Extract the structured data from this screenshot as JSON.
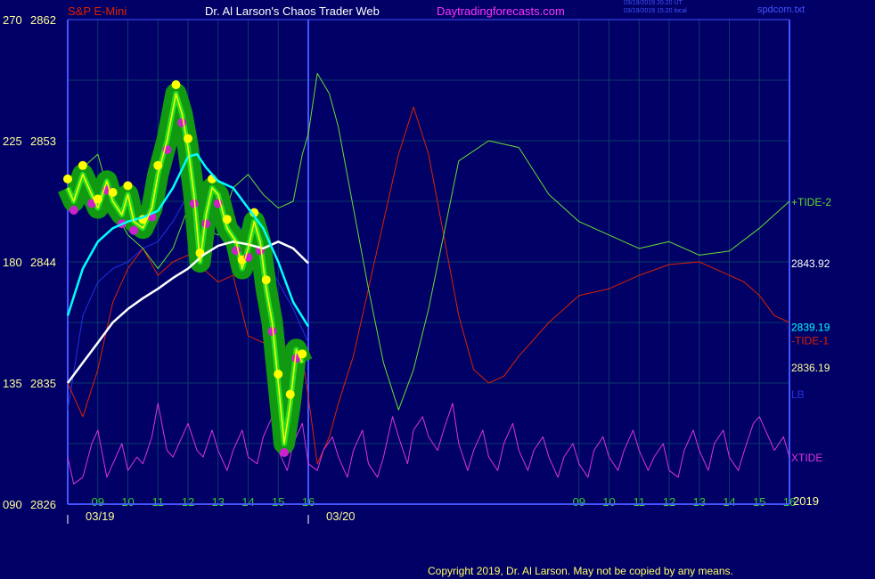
{
  "header": {
    "symbol": "S&P E-Mini",
    "title": "Dr. Al Larson's Chaos Trader Web",
    "site": "Daytradingforecasts.com",
    "timestamp_ut": "03/19/2019 20:20 UT",
    "timestamp_local": "03/19/2019 15:20 local",
    "file": "spdcom.txt",
    "copyright": "Copyright 2019, Dr. Al Larson. May not be copied by any means."
  },
  "colors": {
    "background": "#000066",
    "grid": "#0a3a6a",
    "price": "#ffff00",
    "fast_avg": "#00ffff",
    "slow_avg": "#ffffff",
    "tide_plus2": "#66dd33",
    "tide_minus1": "#dd2200",
    "lb": "#2233dd",
    "xtide": "#dd33dd",
    "halo": "#119911",
    "axis": "#4455ff"
  },
  "chart_data": {
    "type": "line",
    "title": "S&P E-Mini",
    "ylim": [
      2826,
      2862
    ],
    "y_ticks_price": [
      "2826",
      "2835",
      "2844",
      "2853",
      "2862"
    ],
    "y_ticks_angle": [
      "090",
      "135",
      "180",
      "225",
      "270"
    ],
    "x_ticks_day1": [
      "09",
      "10",
      "11",
      "12",
      "13",
      "14",
      "15",
      "16"
    ],
    "x_ticks_day2": [
      "09",
      "10",
      "11",
      "12",
      "13",
      "14",
      "15",
      "16"
    ],
    "dates": [
      "03/19",
      "03/20"
    ],
    "year": "2019",
    "x_range_hours": [
      8.0,
      32.0
    ],
    "price_series": {
      "name": "S&P E-Mini",
      "x": [
        8.0,
        8.2,
        8.5,
        8.8,
        9.0,
        9.3,
        9.5,
        9.8,
        10.0,
        10.2,
        10.5,
        10.8,
        11.0,
        11.3,
        11.6,
        11.8,
        12.0,
        12.2,
        12.4,
        12.6,
        12.8,
        13.0,
        13.3,
        13.6,
        13.8,
        14.0,
        14.2,
        14.4,
        14.6,
        14.8,
        15.0,
        15.2,
        15.4,
        15.6,
        15.8
      ],
      "y": [
        2849.5,
        2848.5,
        2850.5,
        2849.0,
        2848.0,
        2850.0,
        2848.5,
        2847.5,
        2849.0,
        2847.0,
        2846.5,
        2848.0,
        2850.5,
        2853.0,
        2856.5,
        2855.0,
        2852.5,
        2849.0,
        2844.0,
        2847.5,
        2849.5,
        2849.0,
        2846.5,
        2845.5,
        2843.5,
        2845.0,
        2847.0,
        2845.5,
        2842.0,
        2839.5,
        2835.0,
        2830.5,
        2833.5,
        2837.5,
        2836.5
      ]
    },
    "fast_avg": {
      "name": "2839.19",
      "x": [
        8.0,
        8.5,
        9.0,
        9.5,
        10.0,
        10.5,
        11.0,
        11.5,
        12.0,
        12.3,
        12.6,
        13.0,
        13.5,
        14.0,
        14.5,
        15.0,
        15.5,
        16.0
      ],
      "y": [
        2840.0,
        2843.5,
        2845.5,
        2846.5,
        2847.0,
        2847.3,
        2847.8,
        2849.5,
        2851.8,
        2852.0,
        2851.0,
        2850.0,
        2849.5,
        2848.0,
        2846.5,
        2844.0,
        2841.0,
        2839.2
      ]
    },
    "slow_avg": {
      "name": "2843.92",
      "x": [
        8.0,
        8.5,
        9.0,
        9.5,
        10.0,
        10.5,
        11.0,
        11.5,
        12.0,
        12.5,
        13.0,
        13.5,
        14.0,
        14.5,
        15.0,
        15.5,
        16.0
      ],
      "y": [
        2835.0,
        2836.5,
        2838.0,
        2839.5,
        2840.5,
        2841.3,
        2842.0,
        2842.8,
        2843.5,
        2844.5,
        2845.2,
        2845.5,
        2845.3,
        2845.0,
        2845.5,
        2845.0,
        2843.9
      ]
    },
    "tide_plus2": {
      "name": "+TIDE-2",
      "x": [
        8.0,
        8.5,
        9.0,
        9.5,
        10.0,
        10.5,
        11.0,
        11.5,
        12.0,
        12.5,
        13.0,
        13.5,
        14.0,
        14.5,
        15.0,
        15.5,
        15.8,
        16.0,
        16.3,
        16.7,
        17.0,
        17.5,
        18.0,
        18.5,
        19.0,
        19.5,
        20.0,
        20.5,
        21.0,
        22.0,
        23.0,
        24.0,
        25.0,
        26.0,
        27.0,
        28.0,
        29.0,
        30.0,
        31.0,
        31.5,
        32.0
      ],
      "y": [
        2849.0,
        2851.0,
        2852.0,
        2848.0,
        2846.0,
        2845.0,
        2843.5,
        2845.0,
        2848.0,
        2846.5,
        2846.0,
        2849.5,
        2850.5,
        2849.0,
        2848.0,
        2848.5,
        2852.0,
        2853.5,
        2858.0,
        2856.5,
        2854.0,
        2848.0,
        2842.0,
        2836.5,
        2833.0,
        2836.0,
        2840.5,
        2846.0,
        2851.5,
        2853.0,
        2852.5,
        2849.0,
        2847.0,
        2846.0,
        2845.0,
        2845.5,
        2844.5,
        2844.8,
        2846.5,
        2847.5,
        2848.5
      ]
    },
    "tide_minus1": {
      "name": "-TIDE-1",
      "x": [
        8.0,
        8.5,
        9.0,
        9.5,
        10.0,
        10.5,
        11.0,
        11.5,
        12.0,
        12.5,
        13.0,
        13.5,
        14.0,
        14.5,
        15.0,
        15.5,
        15.8,
        16.0,
        16.3,
        16.7,
        17.0,
        17.5,
        18.0,
        18.5,
        19.0,
        19.5,
        20.0,
        20.5,
        21.0,
        21.5,
        22.0,
        22.5,
        23.0,
        24.0,
        25.0,
        26.0,
        27.0,
        28.0,
        29.0,
        29.5,
        30.0,
        30.5,
        31.0,
        31.5,
        32.0
      ],
      "y": [
        2835.0,
        2832.5,
        2836.0,
        2841.0,
        2843.5,
        2845.0,
        2843.0,
        2844.0,
        2844.5,
        2843.5,
        2842.5,
        2843.0,
        2838.5,
        2838.0,
        2837.5,
        2838.0,
        2837.0,
        2834.0,
        2829.0,
        2831.0,
        2833.5,
        2837.0,
        2842.0,
        2847.0,
        2852.0,
        2855.5,
        2852.0,
        2846.0,
        2840.0,
        2836.0,
        2835.0,
        2835.5,
        2837.0,
        2839.5,
        2841.5,
        2842.0,
        2843.0,
        2843.8,
        2844.0,
        2843.5,
        2843.0,
        2842.5,
        2841.5,
        2840.0,
        2839.5
      ]
    },
    "lb": {
      "name": "LB",
      "x": [
        8.0,
        8.5,
        9.0,
        9.5,
        10.0,
        10.5,
        11.0,
        11.5,
        12.0,
        12.5,
        13.0,
        13.5,
        14.0,
        14.5,
        15.0,
        15.5,
        16.0
      ],
      "y": [
        2833.0,
        2840.0,
        2842.5,
        2843.5,
        2844.0,
        2845.0,
        2845.5,
        2847.0,
        2849.0,
        2849.5,
        2848.5,
        2847.0,
        2846.0,
        2844.5,
        2842.5,
        2840.5,
        2838.0
      ]
    },
    "xtide": {
      "name": "XTIDE",
      "x": [
        8.0,
        8.2,
        8.5,
        8.8,
        9.0,
        9.3,
        9.5,
        9.8,
        10.0,
        10.3,
        10.5,
        10.8,
        11.0,
        11.3,
        11.5,
        11.8,
        12.0,
        12.3,
        12.5,
        12.8,
        13.0,
        13.3,
        13.5,
        13.8,
        14.0,
        14.3,
        14.5,
        14.8,
        15.0,
        15.3,
        15.5,
        15.8,
        16.0,
        16.3,
        16.5,
        16.8,
        17.0,
        17.3,
        17.5,
        17.8,
        18.0,
        18.3,
        18.5,
        18.8,
        19.0,
        19.3,
        19.5,
        19.8,
        20.0,
        20.3,
        20.5,
        20.8,
        21.0,
        21.3,
        21.5,
        21.8,
        22.0,
        22.3,
        22.5,
        22.8,
        23.0,
        23.3,
        23.5,
        23.8,
        24.0,
        24.3,
        24.5,
        24.8,
        25.0,
        25.3,
        25.5,
        25.8,
        26.0,
        26.3,
        26.5,
        26.8,
        27.0,
        27.3,
        27.5,
        27.8,
        28.0,
        28.3,
        28.5,
        28.8,
        29.0,
        29.3,
        29.5,
        29.8,
        30.0,
        30.3,
        30.5,
        30.8,
        31.0,
        31.3,
        31.5,
        31.8,
        32.0
      ],
      "y": [
        2829.5,
        2827.5,
        2828.0,
        2830.5,
        2831.5,
        2828.0,
        2829.0,
        2830.5,
        2828.5,
        2829.5,
        2829.0,
        2831.0,
        2833.5,
        2830.0,
        2829.5,
        2831.0,
        2832.0,
        2830.0,
        2829.5,
        2831.5,
        2830.0,
        2828.5,
        2830.0,
        2831.5,
        2829.5,
        2829.0,
        2831.0,
        2832.5,
        2830.0,
        2828.5,
        2830.5,
        2832.0,
        2829.0,
        2828.5,
        2830.0,
        2831.0,
        2829.5,
        2828.0,
        2830.0,
        2831.5,
        2829.0,
        2828.0,
        2829.5,
        2832.5,
        2831.0,
        2829.0,
        2831.5,
        2832.5,
        2831.0,
        2830.0,
        2831.5,
        2833.5,
        2830.5,
        2828.5,
        2830.0,
        2831.5,
        2829.5,
        2828.5,
        2830.5,
        2832.0,
        2830.0,
        2828.5,
        2830.0,
        2831.0,
        2829.5,
        2828.0,
        2829.5,
        2830.5,
        2829.0,
        2828.0,
        2830.0,
        2831.0,
        2829.5,
        2828.5,
        2830.0,
        2831.5,
        2830.0,
        2828.5,
        2829.5,
        2830.5,
        2828.5,
        2828.0,
        2830.0,
        2831.5,
        2830.0,
        2828.5,
        2830.5,
        2831.5,
        2829.5,
        2828.5,
        2830.0,
        2832.0,
        2832.5,
        2831.0,
        2830.0,
        2831.0,
        2829.5
      ]
    },
    "right_labels": [
      {
        "text": "+TIDE-2",
        "value": 2848.5,
        "color": "#66dd33"
      },
      {
        "text": "2843.92",
        "value": 2843.92,
        "color": "#ffffff"
      },
      {
        "text": "2839.19",
        "value": 2839.19,
        "color": "#00ffff"
      },
      {
        "text": "-TIDE-1",
        "value": 2838.2,
        "color": "#dd2200"
      },
      {
        "text": "2836.19",
        "value": 2836.19,
        "color": "#ffff99"
      },
      {
        "text": "LB",
        "value": 2834.2,
        "color": "#2233dd"
      },
      {
        "text": "XTIDE",
        "value": 2829.5,
        "color": "#dd33dd"
      }
    ]
  }
}
